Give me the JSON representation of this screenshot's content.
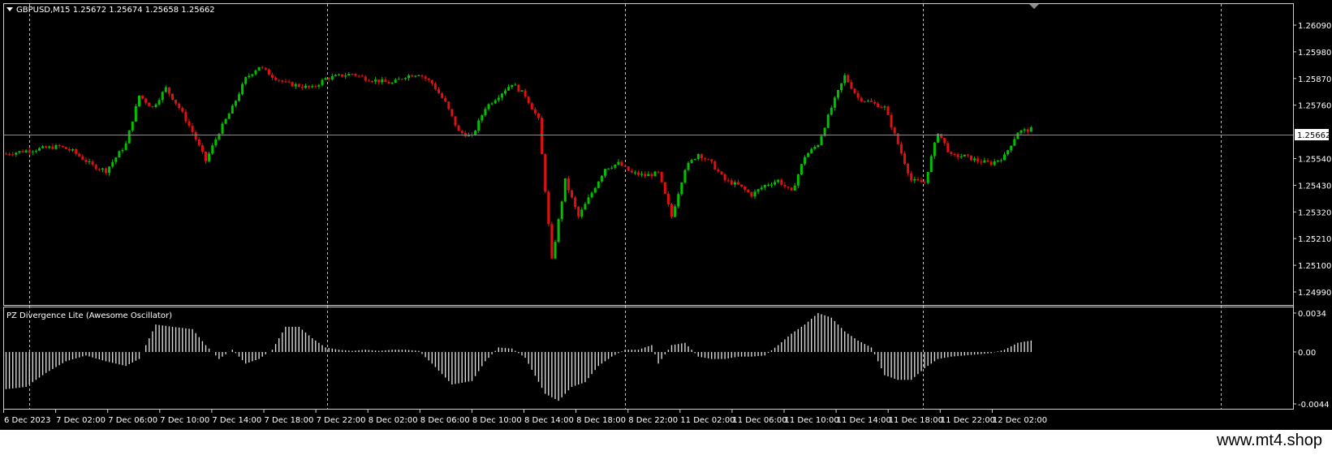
{
  "symbol_header": "GBPUSD,M15  1.25672 1.25674 1.25658 1.25662",
  "indicator_title": "PZ Divergence Lite (Awesome Oscillator)",
  "current_price_label": "1.25662",
  "price_axis": [
    "1.26090",
    "1.25980",
    "1.25870",
    "1.25760",
    "1.25540",
    "1.25430",
    "1.25320",
    "1.25210",
    "1.25100",
    "1.24990"
  ],
  "indicator_axis": [
    "0.0034",
    "0.00",
    "-0.0044"
  ],
  "time_axis": [
    "6 Dec 2023",
    "7 Dec 02:00",
    "7 Dec 06:00",
    "7 Dec 10:00",
    "7 Dec 14:00",
    "7 Dec 18:00",
    "7 Dec 22:00",
    "8 Dec 02:00",
    "8 Dec 06:00",
    "8 Dec 10:00",
    "8 Dec 14:00",
    "8 Dec 18:00",
    "8 Dec 22:00",
    "11 Dec 02:00",
    "11 Dec 06:00",
    "11 Dec 10:00",
    "11 Dec 14:00",
    "11 Dec 18:00",
    "11 Dec 22:00",
    "12 Dec 02:00"
  ],
  "watermark": "www.mt4.shop",
  "colors": {
    "background": "#000000",
    "bull": "#00c000",
    "bear": "#e01010",
    "ao_bars": "#d8d8d8",
    "axis_text": "#ffffff"
  },
  "chart_data": {
    "type": "candlestick",
    "symbol": "GBPUSD",
    "timeframe": "M15",
    "last_ohlc": {
      "open": 1.25672,
      "high": 1.25674,
      "low": 1.25658,
      "close": 1.25662
    },
    "price_ylim": [
      1.24975,
      1.2612
    ],
    "close_path": [
      [
        0,
        1.2556
      ],
      [
        5,
        1.2557
      ],
      [
        10,
        1.2558
      ],
      [
        16,
        1.2559
      ],
      [
        20,
        1.2557
      ],
      [
        26,
        1.2551
      ],
      [
        30,
        1.2549
      ],
      [
        36,
        1.256
      ],
      [
        40,
        1.258
      ],
      [
        44,
        1.2575
      ],
      [
        48,
        1.2583
      ],
      [
        52,
        1.2575
      ],
      [
        56,
        1.2565
      ],
      [
        60,
        1.2553
      ],
      [
        64,
        1.2565
      ],
      [
        68,
        1.2575
      ],
      [
        72,
        1.2587
      ],
      [
        76,
        1.2592
      ],
      [
        80,
        1.2588
      ],
      [
        84,
        1.2585
      ],
      [
        88,
        1.2584
      ],
      [
        92,
        1.2583
      ],
      [
        96,
        1.2587
      ],
      [
        100,
        1.2588
      ],
      [
        104,
        1.2589
      ],
      [
        108,
        1.2587
      ],
      [
        112,
        1.2586
      ],
      [
        116,
        1.2585
      ],
      [
        120,
        1.2588
      ],
      [
        124,
        1.2589
      ],
      [
        128,
        1.2585
      ],
      [
        132,
        1.2577
      ],
      [
        136,
        1.2565
      ],
      [
        140,
        1.2563
      ],
      [
        144,
        1.2575
      ],
      [
        148,
        1.258
      ],
      [
        152,
        1.2585
      ],
      [
        156,
        1.258
      ],
      [
        160,
        1.257
      ],
      [
        164,
        1.2512
      ],
      [
        168,
        1.2545
      ],
      [
        172,
        1.253
      ],
      [
        176,
        1.254
      ],
      [
        180,
        1.255
      ],
      [
        184,
        1.2552
      ],
      [
        188,
        1.2548
      ],
      [
        192,
        1.2547
      ],
      [
        196,
        1.2548
      ],
      [
        200,
        1.253
      ],
      [
        204,
        1.255
      ],
      [
        208,
        1.2556
      ],
      [
        212,
        1.2552
      ],
      [
        216,
        1.2545
      ],
      [
        220,
        1.2543
      ],
      [
        224,
        1.2539
      ],
      [
        228,
        1.2543
      ],
      [
        232,
        1.2545
      ],
      [
        236,
        1.254
      ],
      [
        240,
        1.2555
      ],
      [
        244,
        1.256
      ],
      [
        248,
        1.2575
      ],
      [
        252,
        1.2588
      ],
      [
        256,
        1.2579
      ],
      [
        260,
        1.2577
      ],
      [
        264,
        1.2575
      ],
      [
        268,
        1.256
      ],
      [
        272,
        1.2545
      ],
      [
        276,
        1.2544
      ],
      [
        280,
        1.2565
      ],
      [
        284,
        1.2555
      ],
      [
        288,
        1.2555
      ],
      [
        292,
        1.2553
      ],
      [
        296,
        1.2552
      ],
      [
        300,
        1.2555
      ],
      [
        304,
        1.2565
      ],
      [
        308,
        1.2566
      ]
    ],
    "ao_histogram_envelope": [
      [
        0,
        -0.0032
      ],
      [
        6,
        -0.003
      ],
      [
        12,
        -0.0018
      ],
      [
        18,
        -0.0008
      ],
      [
        24,
        -0.0003
      ],
      [
        30,
        -0.0008
      ],
      [
        36,
        -0.0012
      ],
      [
        40,
        -0.0006
      ],
      [
        45,
        0.0024
      ],
      [
        50,
        0.0022
      ],
      [
        56,
        0.002
      ],
      [
        60,
        0.0006
      ],
      [
        64,
        -0.0006
      ],
      [
        68,
        0.0002
      ],
      [
        72,
        -0.001
      ],
      [
        76,
        -0.0006
      ],
      [
        80,
        0.0002
      ],
      [
        84,
        0.0022
      ],
      [
        88,
        0.0022
      ],
      [
        92,
        0.0012
      ],
      [
        96,
        0.0004
      ],
      [
        100,
        0.0002
      ],
      [
        104,
        0.0001
      ],
      [
        108,
        0.0002
      ],
      [
        112,
        0.0001
      ],
      [
        116,
        0.0002
      ],
      [
        120,
        0.0002
      ],
      [
        124,
        0.0001
      ],
      [
        128,
        -0.001
      ],
      [
        134,
        -0.0028
      ],
      [
        140,
        -0.0025
      ],
      [
        144,
        -0.0008
      ],
      [
        148,
        0.0004
      ],
      [
        152,
        0.0003
      ],
      [
        156,
        -0.0005
      ],
      [
        162,
        -0.0036
      ],
      [
        166,
        -0.0042
      ],
      [
        170,
        -0.003
      ],
      [
        174,
        -0.0026
      ],
      [
        178,
        -0.0012
      ],
      [
        182,
        -0.0004
      ],
      [
        186,
        0.0002
      ],
      [
        190,
        0.0002
      ],
      [
        194,
        0.0006
      ],
      [
        196,
        -0.001
      ],
      [
        200,
        0.0006
      ],
      [
        204,
        0.0008
      ],
      [
        208,
        -0.0004
      ],
      [
        212,
        -0.0006
      ],
      [
        216,
        -0.0006
      ],
      [
        220,
        -0.0004
      ],
      [
        224,
        -0.0004
      ],
      [
        228,
        -0.0003
      ],
      [
        232,
        0.0006
      ],
      [
        236,
        0.0016
      ],
      [
        240,
        0.0024
      ],
      [
        244,
        0.0034
      ],
      [
        248,
        0.003
      ],
      [
        252,
        0.0018
      ],
      [
        256,
        0.001
      ],
      [
        260,
        0.0004
      ],
      [
        264,
        -0.002
      ],
      [
        268,
        -0.0024
      ],
      [
        272,
        -0.0024
      ],
      [
        276,
        -0.0014
      ],
      [
        280,
        -0.0006
      ],
      [
        284,
        -0.0004
      ],
      [
        288,
        -0.0003
      ],
      [
        292,
        -0.0002
      ],
      [
        296,
        -0.0001
      ],
      [
        300,
        0.0002
      ],
      [
        304,
        0.0008
      ],
      [
        308,
        0.001
      ]
    ],
    "ao_ylim": [
      -0.0044,
      0.0034
    ]
  }
}
